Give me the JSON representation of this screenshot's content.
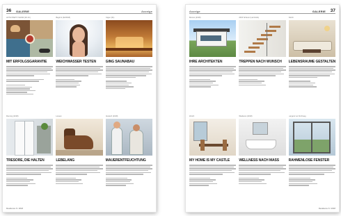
{
  "left_page": {
    "page_number": "36",
    "brand": "GALERIE",
    "section": "Anzeige",
    "footer": "Residence 6 / 2018",
    "row1": [
      {
        "category": "AKTIV-PARTY-SHOW (30.10.)",
        "title": "MIT ERFOLGSGARANTIE",
        "image": "collage"
      },
      {
        "category": "Beginnt (02/2018)",
        "title": "WEICHWASSER TESTEN",
        "image": "face"
      },
      {
        "category": "Fügen (01)",
        "title": "GING SAUNABAU",
        "image": "sauna"
      }
    ],
    "row2": [
      {
        "category": "Fleming (2018)",
        "title": "TRESORE, DIE HALTEN",
        "image": "fridge"
      },
      {
        "category": "Lossen",
        "title": "LEBELANG",
        "image": "chair"
      },
      {
        "category": "Deutsch (2018)",
        "title": "MAUERENTFEUCHTUNG",
        "image": "workers"
      }
    ]
  },
  "right_page": {
    "page_number": "37",
    "brand": "GALERIE",
    "section": "Anzeige",
    "footer": "Residence 6 / 2018",
    "row1": [
      {
        "category": "Bonnet (2018)",
        "title": "IHRE ARCHITEKTEN",
        "image": "house"
      },
      {
        "category": "2015 Scherer (Lehnhofs)",
        "title": "TREPPEN NACH WUNSCH",
        "image": "stairs"
      },
      {
        "category": "Zürich",
        "title": "LEBENSRÄUME GESTALTEN",
        "image": "living"
      }
    ],
    "row2": [
      {
        "category": "Zürich",
        "title": "MY HOME IS MY CASTLE",
        "image": "dining"
      },
      {
        "category": "Wiederes (2018)",
        "title": "WELLNESS NACH MASS",
        "image": "bath"
      },
      {
        "category": "Langenz an Kirchweg",
        "title": "RAHMENLOSE FENSTER",
        "image": "window"
      }
    ]
  }
}
